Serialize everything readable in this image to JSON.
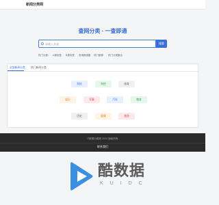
{
  "header": {
    "site_title": "新闻分类网"
  },
  "hero": {
    "title": "查网分类 · 一查即通"
  },
  "search": {
    "placeholder": "请输入关键…",
    "button_label": "搜索"
  },
  "hot": {
    "label": "热门分类：",
    "items": [
      "A类标签",
      "B类标签",
      "查询精选集",
      "热门推荐",
      "热门分类集合"
    ]
  },
  "panel": {
    "tabs": [
      {
        "label": "全部新闻分类"
      },
      {
        "label": "热门新闻分类"
      }
    ],
    "chips": [
      {
        "label": "科技",
        "bg": "#e8f0ff",
        "fg": "#3a6fd8"
      },
      {
        "label": "财经",
        "bg": "#e6f7ea",
        "fg": "#3aa556"
      },
      {
        "label": "体育",
        "bg": "#f0f0f0",
        "fg": "#666666"
      },
      {
        "label": "娱乐",
        "bg": "#fff3e3",
        "fg": "#d98a2b"
      },
      {
        "label": "军事",
        "bg": "#fde9e9",
        "fg": "#d84a4a"
      },
      {
        "label": "汽车",
        "bg": "#e8f0ff",
        "fg": "#3a6fd8"
      },
      {
        "label": "教育",
        "bg": "#e6f7ea",
        "fg": "#3aa556"
      },
      {
        "label": "历史",
        "bg": "#f0f0f0",
        "fg": "#666666"
      },
      {
        "label": "健康",
        "bg": "#fff3e3",
        "fg": "#d98a2b"
      },
      {
        "label": "旅游",
        "bg": "#fde9e9",
        "fg": "#d84a4a"
      }
    ]
  },
  "footer": {
    "copyright": "©新闻分类网 2024 版权所有",
    "contact": "联系我们"
  },
  "watermark": {
    "name": "酷数据",
    "sub": "KUIDC"
  },
  "colors": {
    "accent": "#3a6fd8",
    "footer_bg": "#2b2b2b",
    "logo_blue": "#3b8fe0"
  }
}
